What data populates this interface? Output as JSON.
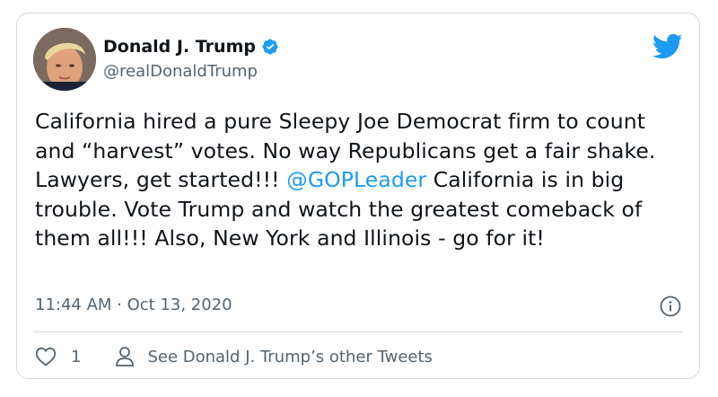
{
  "author": {
    "display_name": "Donald J. Trump",
    "handle": "@realDonaldTrump",
    "verified": true
  },
  "tweet": {
    "text_before_mention": "California hired a pure Sleepy Joe Democrat firm to count and “harvest” votes. No way Republicans get a fair shake. Lawyers, get started!!! ",
    "mention": "@GOPLeader",
    "text_after_mention": " California is in big trouble. Vote Trump and watch the greatest comeback of them all!!! Also, New York and Illinois - go for it!",
    "timestamp": "11:44 AM · Oct 13, 2020"
  },
  "actions": {
    "like_count": "1",
    "other_tweets_label": "See Donald J. Trump’s other Tweets"
  },
  "icons": {
    "brand": "twitter-bird-icon",
    "verified": "verified-badge-icon",
    "info": "info-icon",
    "like": "heart-icon",
    "profile": "person-icon"
  },
  "colors": {
    "accent": "#1d9bf0",
    "text": "#0f1419",
    "secondary": "#536471",
    "border": "#cfd9de"
  }
}
